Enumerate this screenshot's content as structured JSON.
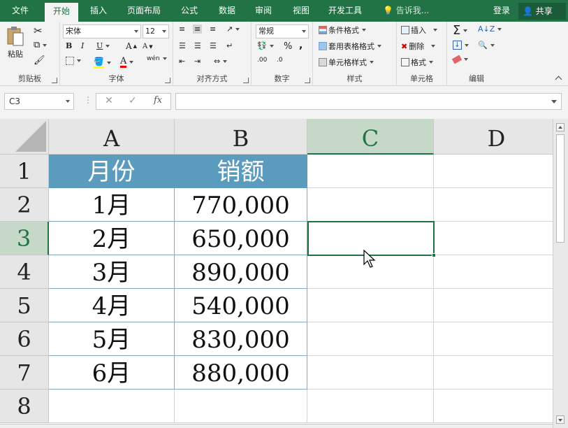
{
  "tabs": [
    "文件",
    "开始",
    "插入",
    "页面布局",
    "公式",
    "数据",
    "审阅",
    "视图",
    "开发工具"
  ],
  "active_tab": "开始",
  "tell_me": "告诉我...",
  "login": "登录",
  "share": "共享",
  "ribbon": {
    "clipboard": {
      "label": "剪贴板",
      "paste": "粘贴"
    },
    "font": {
      "label": "字体",
      "font_name": "宋体",
      "font_size": "12",
      "bold": "B",
      "italic": "I",
      "underline": "U",
      "grow": "A",
      "shrink": "A",
      "font_color": "A",
      "phonetic": "wén"
    },
    "alignment": {
      "label": "对齐方式"
    },
    "number": {
      "label": "数字",
      "format": "常规",
      "percent": "%",
      "comma": ","
    },
    "styles": {
      "label": "样式",
      "conditional": "条件格式",
      "table": "套用表格格式",
      "cell_styles": "单元格样式"
    },
    "cells": {
      "label": "单元格",
      "insert": "插入",
      "delete": "删除",
      "format": "格式"
    },
    "editing": {
      "label": "编辑"
    }
  },
  "formula_bar": {
    "name_box": "C3",
    "fx": "fx",
    "cancel": "✕",
    "enter": "✓",
    "value": ""
  },
  "columns": [
    "A",
    "B",
    "C",
    "D"
  ],
  "rows": [
    "1",
    "2",
    "3",
    "4",
    "5",
    "6",
    "7",
    "8"
  ],
  "table": {
    "headers": [
      "月份",
      "销额"
    ],
    "rows": [
      [
        "1月",
        "770,000"
      ],
      [
        "2月",
        "650,000"
      ],
      [
        "3月",
        "890,000"
      ],
      [
        "4月",
        "540,000"
      ],
      [
        "5月",
        "830,000"
      ],
      [
        "6月",
        "880,000"
      ]
    ]
  },
  "colors": {
    "accent": "#217346",
    "table_header": "#5b9bbd",
    "selection_header": "#c6d9c9"
  }
}
